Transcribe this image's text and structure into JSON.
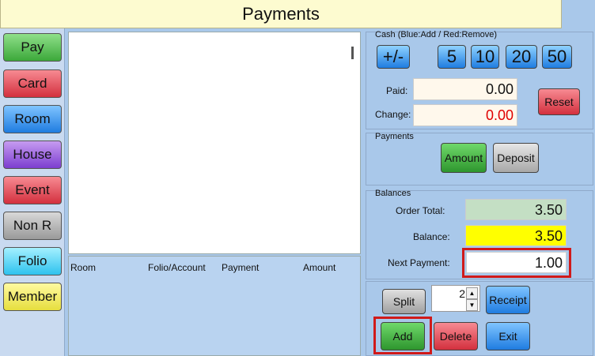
{
  "window": {
    "title": "Payments"
  },
  "left_buttons": [
    {
      "label": "Pay",
      "color": "#3ca83a"
    },
    {
      "label": "Card",
      "color": "#d3303e"
    },
    {
      "label": "Room",
      "color": "#1f7ce0"
    },
    {
      "label": "House",
      "color": "#7c3ed0"
    },
    {
      "label": "Event",
      "color": "#d3303e"
    },
    {
      "label": "Non R",
      "color": "#9a9a9a"
    },
    {
      "label": "Folio",
      "color": "#2ec2ee"
    },
    {
      "label": "Member",
      "color": "#e6de3e"
    }
  ],
  "table": {
    "headers": [
      "Room",
      "Folio/Account",
      "Payment",
      "Amount"
    ]
  },
  "cash": {
    "group_label": "Cash (Blue:Add / Red:Remove)",
    "toggle_label": "+/-",
    "denominations": [
      "5",
      "10",
      "20",
      "50"
    ],
    "paid_label": "Paid:",
    "paid_value": "0.00",
    "change_label": "Change:",
    "change_value": "0.00",
    "reset_label": "Reset"
  },
  "payments": {
    "group_label": "Payments",
    "amount_label": "Amount",
    "deposit_label": "Deposit"
  },
  "balances": {
    "group_label": "Balances",
    "order_total_label": "Order Total:",
    "order_total_value": "3.50",
    "balance_label": "Balance:",
    "balance_value": "3.50",
    "next_payment_label": "Next Payment:",
    "next_payment_value": "1.00"
  },
  "actions": {
    "split_label": "Split",
    "split_count": "2",
    "receipt_label": "Receipt",
    "add_label": "Add",
    "delete_label": "Delete",
    "exit_label": "Exit"
  },
  "colors": {
    "highlight": "#d01a1a",
    "change_text": "#e00000",
    "balance_bg": "#ffff00",
    "order_total_bg": "#c4dfc4"
  }
}
